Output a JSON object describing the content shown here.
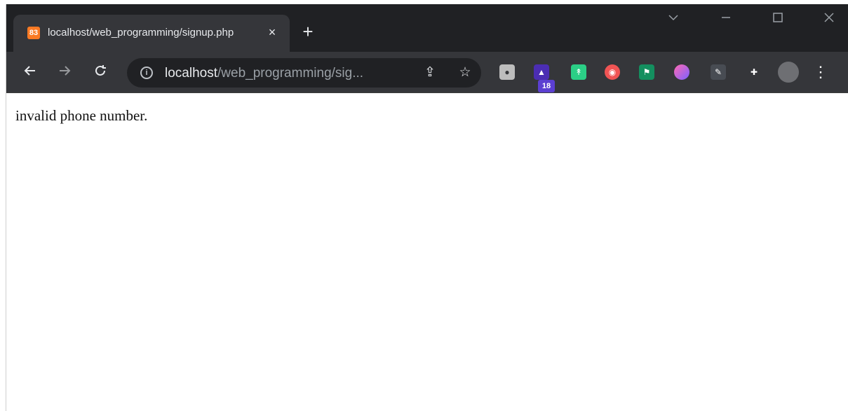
{
  "browser": {
    "tab_title": "localhost/web_programming/signup.php",
    "favicon_label": "83",
    "new_tab_label": "+",
    "close_tab_label": "×",
    "url_host": "localhost",
    "url_path": "/web_programming/sig...",
    "extension_badge": "18"
  },
  "page": {
    "message": "invalid phone number."
  },
  "icons": {
    "tab_dropdown": "chevron-down-icon",
    "minimize": "minimize-icon",
    "maximize": "maximize-icon",
    "close": "close-icon",
    "back": "arrow-left-icon",
    "forward": "arrow-right-icon",
    "reload": "reload-icon",
    "info": "info-icon",
    "share": "share-icon",
    "bookmark": "star-icon",
    "extensions": "puzzle-icon",
    "menu": "more-vertical-icon"
  },
  "colors": {
    "chrome_dark": "#202124",
    "toolbar": "#35363a",
    "text_light": "#e8eaed",
    "accent_orange": "#fb7a24"
  }
}
